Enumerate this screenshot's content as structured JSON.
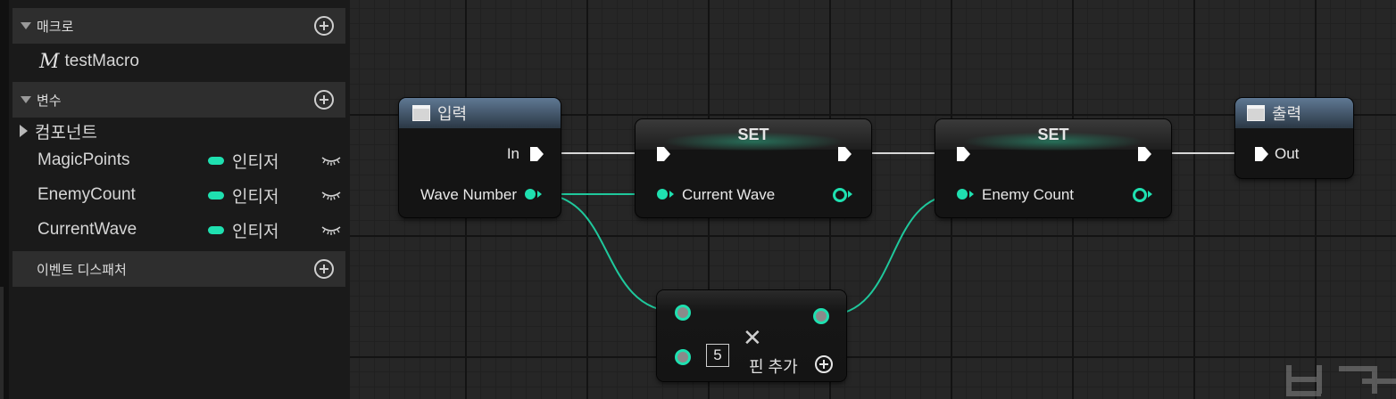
{
  "panel": {
    "macros": {
      "header": "매크로",
      "items": [
        {
          "icon": "M",
          "label": "testMacro"
        }
      ]
    },
    "variables": {
      "header": "변수",
      "components_label": "컴포넌트",
      "items": [
        {
          "name": "MagicPoints",
          "type": "인티저"
        },
        {
          "name": "EnemyCount",
          "type": "인티저"
        },
        {
          "name": "CurrentWave",
          "type": "인티저"
        }
      ]
    },
    "event_dispatchers": {
      "header": "이벤트 디스패처"
    }
  },
  "graph": {
    "input_node": {
      "title": "입력",
      "exec_out": "In",
      "data_out": "Wave Number"
    },
    "set_node_1": {
      "title": "SET",
      "data_in": "Current Wave"
    },
    "set_node_2": {
      "title": "SET",
      "data_in": "Enemy Count"
    },
    "output_node": {
      "title": "출력",
      "exec_in": "Out"
    },
    "add_node": {
      "value": "5",
      "add_pin_label": "핀 추가"
    }
  },
  "colors": {
    "integer_pin": "#1fe0b0",
    "exec_pin": "#ffffff",
    "node_header_blue": "#4e6580"
  }
}
